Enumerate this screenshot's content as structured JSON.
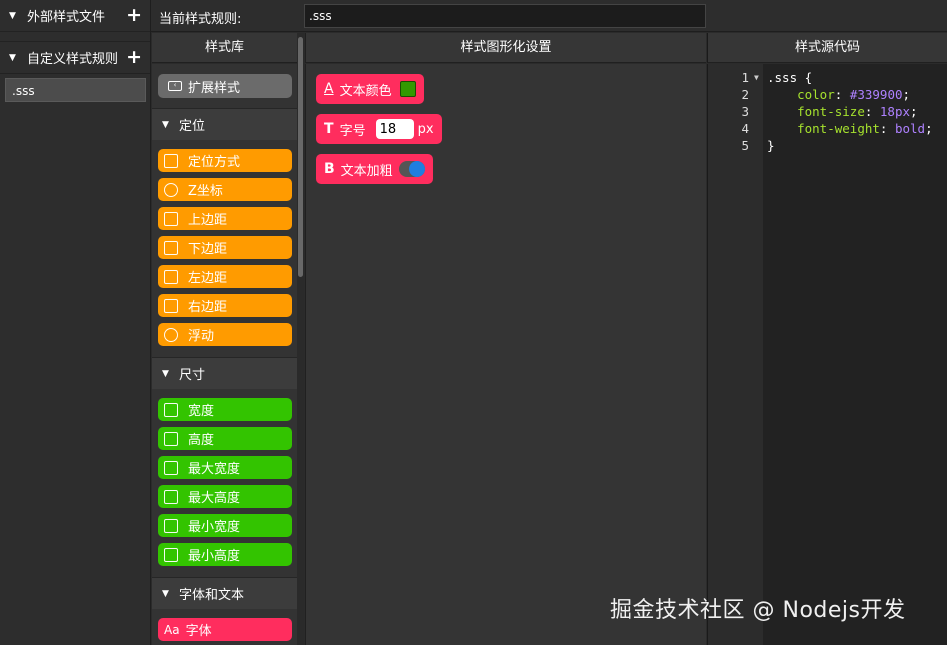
{
  "sidebar": {
    "external_section": "外部样式文件",
    "custom_section": "自定义样式规则",
    "rules": [
      ".sss"
    ]
  },
  "topbar": {
    "label": "当前样式规则:",
    "rule_value": ".sss"
  },
  "columns": {
    "library": "样式库",
    "graphical": "样式图形化设置",
    "source": "样式源代码"
  },
  "library": {
    "extend_button": "扩展样式",
    "categories": {
      "position": {
        "title": "定位",
        "items": [
          "定位方式",
          "Z坐标",
          "上边距",
          "下边距",
          "左边距",
          "右边距",
          "浮动"
        ]
      },
      "size": {
        "title": "尺寸",
        "items": [
          "宽度",
          "高度",
          "最大宽度",
          "最大高度",
          "最小宽度",
          "最小高度"
        ]
      },
      "font": {
        "title": "字体和文本",
        "items": [
          "字体"
        ]
      }
    },
    "colors": {
      "position": "#ff9b00",
      "size": "#33c400",
      "font": "#ff2d5e"
    }
  },
  "settings": {
    "text_color": {
      "label": "文本颜色",
      "icon": "A",
      "value": "#339900"
    },
    "font_size": {
      "label": "字号",
      "icon": "T",
      "value": "18",
      "unit": "px"
    },
    "bold": {
      "label": "文本加粗",
      "icon": "B",
      "value": "on"
    }
  },
  "source": {
    "lines": [
      {
        "n": "1",
        "selector": ".sss {"
      },
      {
        "n": "2",
        "prop": "color",
        "value": "#339900"
      },
      {
        "n": "3",
        "prop": "font-size",
        "value": "18px"
      },
      {
        "n": "4",
        "prop": "font-weight",
        "value": "bold"
      },
      {
        "n": "5",
        "close": "}"
      }
    ]
  },
  "watermark": "掘金技术社区 @ Nodejs开发"
}
